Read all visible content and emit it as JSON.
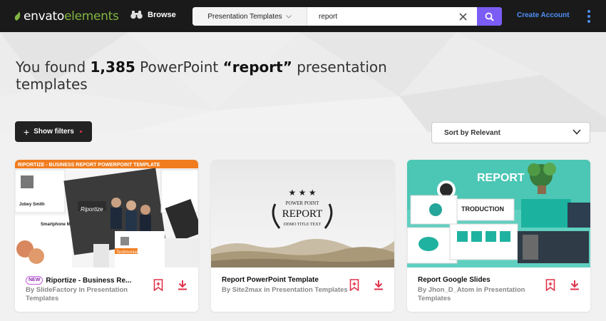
{
  "header": {
    "logo_main": "envato",
    "logo_sub": "elements",
    "browse_label": "Browse",
    "search": {
      "category": "Presentation Templates",
      "query": "report"
    },
    "create_account": "Create Account"
  },
  "results": {
    "prefix": "You found",
    "count": "1,385",
    "middle": "PowerPoint",
    "query_quoted": "“report”",
    "suffix": "presentation templates"
  },
  "filters": {
    "show_label": "Show filters",
    "sort_label": "Sort by Relevant"
  },
  "cards": [
    {
      "badge": "NEW",
      "title": "Riportize - Business Re...",
      "by": "By SlideFactory in Presentation Templates",
      "thumb_banner": "RIPORTIZE - BUSINESS REPORT POWERPOINT TEMPLATE",
      "thumb_labels": [
        "Riportize",
        "Jobey Smith",
        "Smartphone Mockup",
        "Testimonial"
      ]
    },
    {
      "title": "Report PowerPoint Template",
      "by": "By Site2max in Presentation Templates",
      "thumb_labels": [
        "POWER POINT",
        "REPORT",
        "DEMO TITLE TEXT"
      ]
    },
    {
      "title": "Report Google Slides",
      "by": "By Jhon_D_Atom in Presentation Templates",
      "thumb_labels": [
        "REPORT",
        "TRODUCTION"
      ]
    }
  ],
  "colors": {
    "topbar": "#1a1a1a",
    "logo_green": "#82b541",
    "search_button": "#7b5cf5",
    "link_blue": "#4f8ff7",
    "action_pink": "#e0324b",
    "badge_purple": "#c35ee0"
  },
  "icons": {
    "browse": "binoculars-icon",
    "clear": "close-icon",
    "search": "search-icon",
    "menu": "kebab-menu-icon",
    "add_collection": "bookmark-plus-icon",
    "download": "download-icon",
    "sort": "chevron-down-icon"
  }
}
